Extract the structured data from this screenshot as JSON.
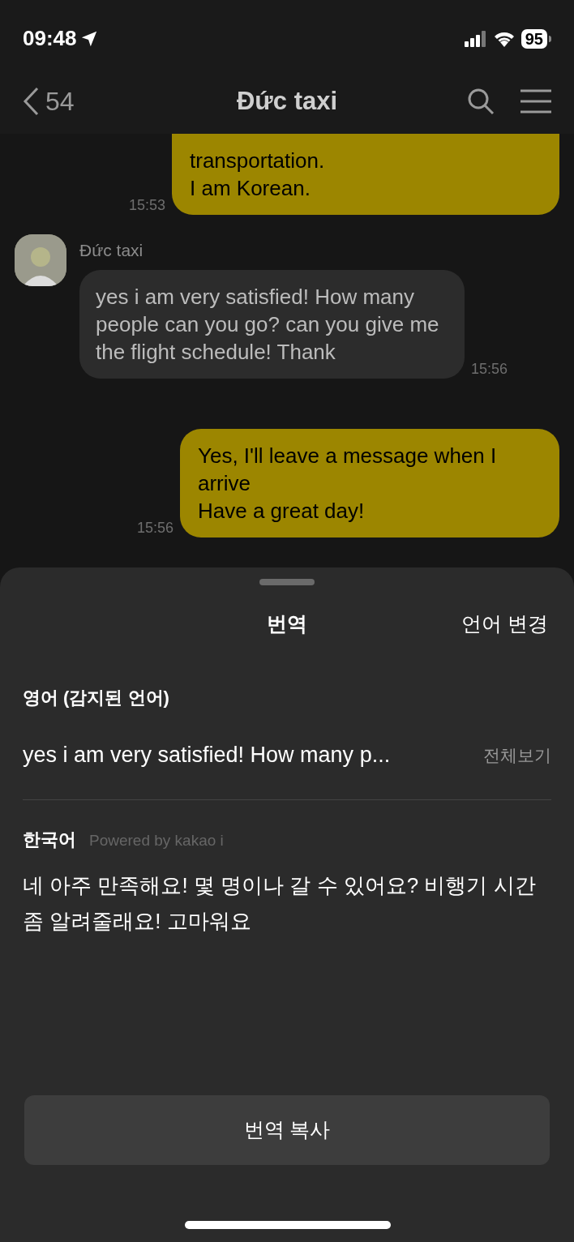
{
  "status_bar": {
    "time": "09:48",
    "battery": "95"
  },
  "nav": {
    "back_count": "54",
    "title": "Đức taxi"
  },
  "messages": [
    {
      "kind": "outgoing",
      "time": "15:53",
      "lines": [
        {
          "text": "transportation."
        },
        {
          "text": "I am Korean."
        }
      ]
    },
    {
      "kind": "incoming",
      "sender": "Đức taxi",
      "time": "15:56",
      "lines": [
        {
          "text": "yes i am very satisfied! How many people can you go? can you give me the flight schedule! Thank"
        }
      ]
    },
    {
      "kind": "outgoing",
      "time": "15:56",
      "lines": [
        {
          "text": "Yes, I'll leave a message when I arrive"
        },
        {
          "text": "Have a great day!"
        }
      ]
    }
  ],
  "sheet": {
    "title": "번역",
    "change_language": "언어 변경",
    "source_label": "영어 (감지된 언어)",
    "source_text": "yes i am very satisfied! How many p...",
    "view_all": "전체보기",
    "target_label": "한국어",
    "powered_by": "Powered by kakao i",
    "target_text": "네 아주 만족해요! 몇 명이나 갈 수 있어요? 비행기 시간 좀 알려줄래요! 고마워요",
    "copy_button": "번역 복사"
  }
}
